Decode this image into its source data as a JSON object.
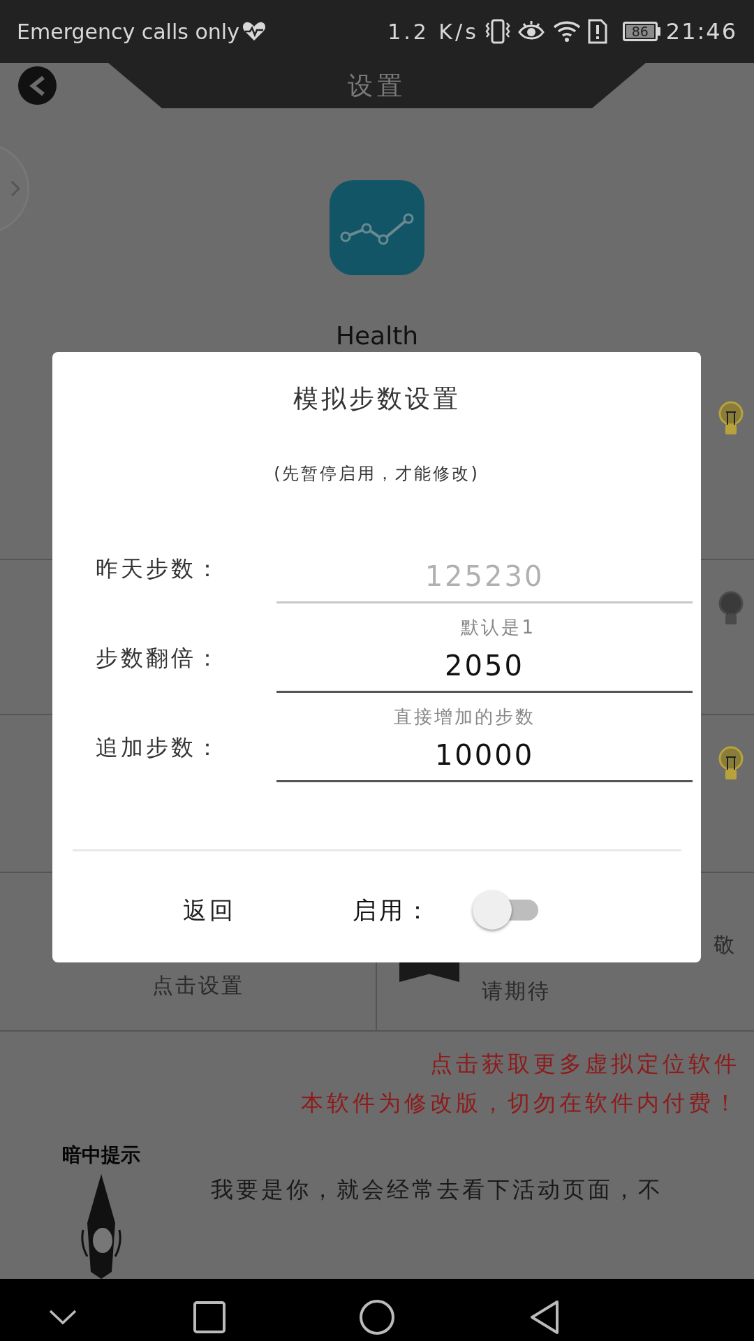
{
  "status_bar": {
    "carrier": "Emergency calls only",
    "speed": "1.2 K/s",
    "battery": "86",
    "time": "21:46"
  },
  "header": {
    "title": "设置"
  },
  "app": {
    "name": "Health"
  },
  "bulbs": [
    {
      "lit": true
    },
    {
      "lit": false
    },
    {
      "lit": true
    }
  ],
  "tiles": [
    {
      "text": "点击设置"
    },
    {
      "text": "敬",
      "text_2": "请期待"
    }
  ],
  "notices": [
    "点击获取更多虚拟定位软件",
    "本软件为修改版，切勿在软件内付费！"
  ],
  "tip": {
    "title": "暗中提示",
    "text": "我要是你，就会经常去看下活动页面，不"
  },
  "dialog": {
    "title": "模拟步数设置",
    "subtitle": "(先暂停启用，才能修改)",
    "fields": [
      {
        "label": "昨天步数：",
        "value": "125230",
        "disabled": true
      },
      {
        "hint": "默认是1",
        "label": "步数翻倍：",
        "value": "2050",
        "disabled": false
      },
      {
        "hint": "直接增加的步数",
        "label": "追加步数：",
        "value": "10000",
        "disabled": false
      }
    ],
    "back_button": "返回",
    "switch_label": "启用：",
    "switch_on": false
  }
}
